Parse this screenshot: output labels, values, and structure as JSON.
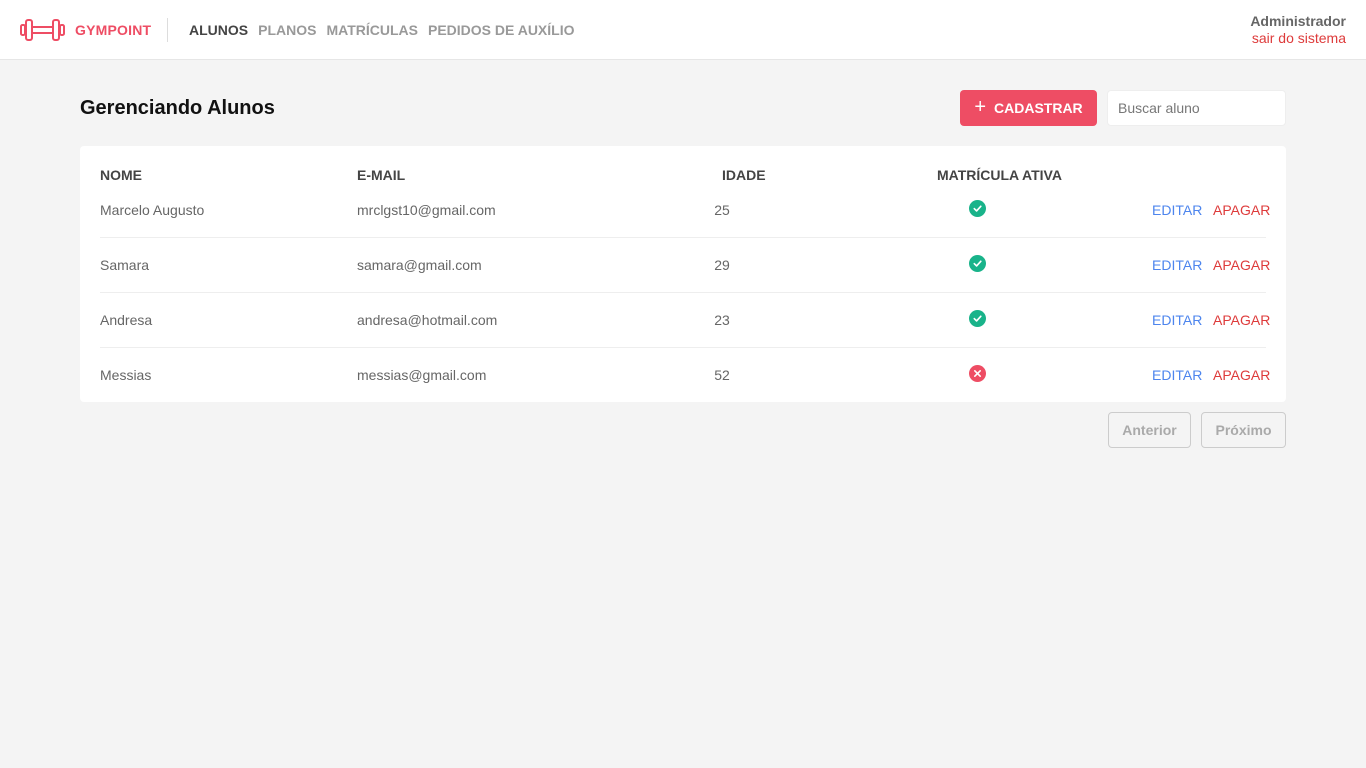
{
  "app": {
    "brand": "GYMPOINT",
    "accent_color": "#ee4d64"
  },
  "nav": {
    "items": [
      {
        "label": "ALUNOS",
        "active": true
      },
      {
        "label": "PLANOS",
        "active": false
      },
      {
        "label": "MATRÍCULAS",
        "active": false
      },
      {
        "label": "PEDIDOS DE AUXÍLIO",
        "active": false
      }
    ]
  },
  "user": {
    "name": "Administrador",
    "logout": "sair do sistema"
  },
  "page": {
    "title": "Gerenciando Alunos",
    "add_label": "CADASTRAR",
    "add_icon": "plus-icon",
    "search_placeholder": "Buscar aluno",
    "search_value": ""
  },
  "table": {
    "headers": {
      "name": "NOME",
      "email": "E-MAIL",
      "age": "IDADE",
      "active": "MATRÍCULA ATIVA"
    },
    "rows": [
      {
        "name": "Marcelo Augusto",
        "email": "mrclgst10@gmail.com",
        "age": "25",
        "active": true
      },
      {
        "name": "Samara",
        "email": "samara@gmail.com",
        "age": "29",
        "active": true
      },
      {
        "name": "Andresa",
        "email": "andresa@hotmail.com",
        "age": "23",
        "active": true
      },
      {
        "name": "Messias",
        "email": "messias@gmail.com",
        "age": "52",
        "active": false
      }
    ],
    "edit_label": "EDITAR",
    "delete_label": "APAGAR",
    "status_colors": {
      "active": "#19b38a",
      "inactive": "#ee4d64"
    }
  },
  "pagination": {
    "prev_label": "Anterior",
    "next_label": "Próximo"
  }
}
